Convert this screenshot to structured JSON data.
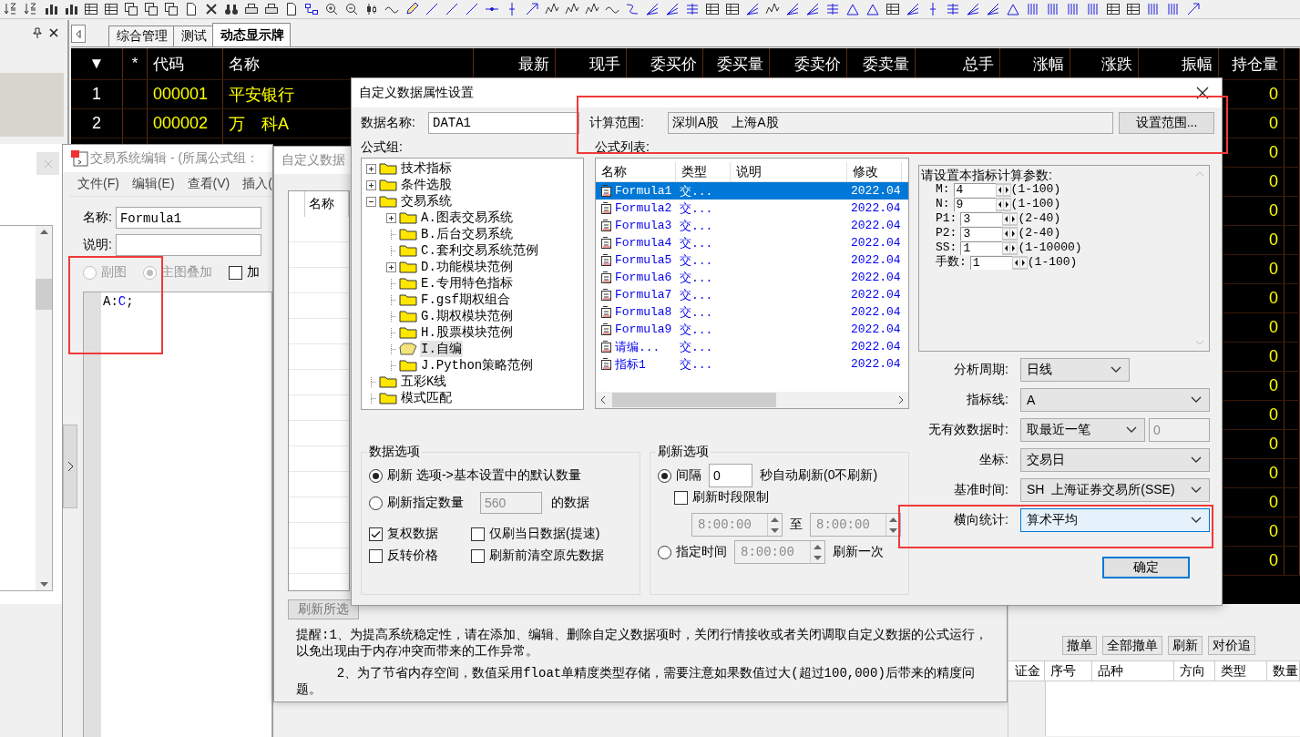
{
  "tabs": [
    {
      "label": "综合管理",
      "selected": false
    },
    {
      "label": "测试",
      "selected": false
    },
    {
      "label": "动态显示牌",
      "selected": true
    }
  ],
  "quote_table": {
    "columns": [
      "▼",
      "*",
      "代码",
      "名称",
      "最新",
      "现手",
      "委买价",
      "委买量",
      "委卖价",
      "委卖量",
      "总手",
      "涨幅",
      "涨跌",
      "振幅",
      "持仓量"
    ],
    "rows": [
      {
        "index": "1",
        "code": "000001",
        "name": "平安银行",
        "open_interest": "0"
      },
      {
        "index": "2",
        "code": "000002",
        "name": "万　科A",
        "open_interest": "0"
      },
      {
        "open_interest": "0"
      },
      {
        "open_interest": "0"
      },
      {
        "open_interest": "0"
      },
      {
        "open_interest": "0"
      },
      {
        "open_interest": "0"
      },
      {
        "open_interest": "0"
      },
      {
        "open_interest": "0"
      },
      {
        "open_interest": "0"
      },
      {
        "open_interest": "0"
      },
      {
        "open_interest": "0"
      },
      {
        "open_interest": "0"
      },
      {
        "open_interest": "0"
      },
      {
        "open_interest": "0"
      },
      {
        "open_interest": "0"
      },
      {
        "open_interest": "0"
      }
    ]
  },
  "editor_window": {
    "title": "交易系统编辑 - (所属公式组：",
    "menu": [
      "文件(F)",
      "编辑(E)",
      "查看(V)",
      "插入("
    ],
    "name_label": "名称:",
    "name_value": "Formula1",
    "desc_label": "说明:",
    "chart_modes": [
      {
        "label": "副图",
        "selected": false,
        "disabled": true
      },
      {
        "label": "主图叠加",
        "selected": true,
        "disabled": true
      }
    ],
    "encrypt": {
      "label": "加",
      "checked": false
    },
    "code": [
      {
        "text": "A:",
        "kind": "plain"
      },
      {
        "text": "C",
        "kind": "keyword"
      },
      {
        "text": ";",
        "kind": "plain"
      }
    ],
    "highlighted": true
  },
  "data_window": {
    "title": "自定义数据",
    "list_columns": [
      "名称"
    ],
    "buttons": [
      "刷新所选"
    ],
    "notes": [
      "提醒:1、为提高系统稳定性，请在添加、编辑、删除自定义数据项时，关闭行情接收或者关闭调取自定义数据的公式运行，以免出现由于内存冲突而带来的工作异常。",
      "2、为了节省内存空间，数值采用float单精度类型存储，需要注意如果数值过大(超过100,000)后带来的精度问题。"
    ]
  },
  "dialog": {
    "title": "自定义数据属性设置",
    "data_name_label": "数据名称:",
    "data_name": "DATA1",
    "range": {
      "label": "计算范围:",
      "value": "深圳A股　上海A股",
      "button": "设置范围...",
      "highlighted": true
    },
    "group_label": "公式组:",
    "list_label": "公式列表:",
    "tree": [
      {
        "label": "技术指标",
        "expandable": true,
        "expanded": false,
        "selected": false
      },
      {
        "label": "条件选股",
        "expandable": true,
        "expanded": false,
        "selected": false
      },
      {
        "label": "交易系统",
        "expandable": true,
        "expanded": true,
        "selected": false,
        "children": [
          {
            "label": "A.图表交易系统",
            "expandable": true,
            "expanded": false,
            "selected": false
          },
          {
            "label": "B.后台交易系统",
            "expandable": false,
            "expanded": false,
            "selected": false
          },
          {
            "label": "C.套利交易系统范例",
            "expandable": false,
            "expanded": false,
            "selected": false
          },
          {
            "label": "D.功能模块范例",
            "expandable": true,
            "expanded": false,
            "selected": false
          },
          {
            "label": "E.专用特色指标",
            "expandable": false,
            "expanded": false,
            "selected": false
          },
          {
            "label": "F.gsf期权组合",
            "expandable": false,
            "expanded": false,
            "selected": false
          },
          {
            "label": "G.期权模块范例",
            "expandable": false,
            "expanded": false,
            "selected": false
          },
          {
            "label": "H.股票模块范例",
            "expandable": false,
            "expanded": false,
            "selected": false
          },
          {
            "label": "I.自编",
            "expandable": false,
            "expanded": false,
            "selected": true
          },
          {
            "label": "J.Python策略范例",
            "expandable": false,
            "expanded": false,
            "selected": false
          }
        ]
      },
      {
        "label": "五彩K线",
        "expandable": false,
        "expanded": false,
        "selected": false
      },
      {
        "label": "模式匹配",
        "expandable": false,
        "expanded": false,
        "selected": false
      }
    ],
    "formula_columns": [
      "名称",
      "类型",
      "说明",
      "修改"
    ],
    "formulas": [
      {
        "name": "Formula1",
        "type": "交...",
        "date": "2022.04",
        "selected": true
      },
      {
        "name": "Formula2",
        "type": "交...",
        "date": "2022.04",
        "selected": false
      },
      {
        "name": "Formula3",
        "type": "交...",
        "date": "2022.04",
        "selected": false
      },
      {
        "name": "Formula4",
        "type": "交...",
        "date": "2022.04",
        "selected": false
      },
      {
        "name": "Formula5",
        "type": "交...",
        "date": "2022.04",
        "selected": false
      },
      {
        "name": "Formula6",
        "type": "交...",
        "date": "2022.04",
        "selected": false
      },
      {
        "name": "Formula7",
        "type": "交...",
        "date": "2022.04",
        "selected": false
      },
      {
        "name": "Formula8",
        "type": "交...",
        "date": "2022.04",
        "selected": false
      },
      {
        "name": "Formula9",
        "type": "交...",
        "date": "2022.04",
        "selected": false
      },
      {
        "name": "请编...",
        "type": "交...",
        "date": "2022.04",
        "selected": false
      },
      {
        "name": "指标1",
        "type": "交...",
        "date": "2022.04",
        "selected": false
      }
    ],
    "params": {
      "prompt": "请设置本指标计算参数:",
      "items": [
        {
          "name": "M:",
          "value": "4",
          "range": "(1-100)"
        },
        {
          "name": "N:",
          "value": "9",
          "range": "(1-100)"
        },
        {
          "name": "P1:",
          "value": "3",
          "range": "(2-40)"
        },
        {
          "name": "P2:",
          "value": "3",
          "range": "(2-40)"
        },
        {
          "name": "SS:",
          "value": "1",
          "range": "(1-10000)"
        },
        {
          "name": "手数:",
          "value": "1",
          "range": "(1-100)"
        }
      ]
    },
    "form": [
      {
        "label": "分析周期:",
        "value": "日线",
        "kind": "short",
        "highlighted": false
      },
      {
        "label": "指标线:",
        "value": "A",
        "kind": "wide",
        "highlighted": false
      },
      {
        "label": "无有效数据时:",
        "value": "取最近一笔",
        "kind": "with_input",
        "extra": "0",
        "highlighted": false
      },
      {
        "label": "坐标:",
        "value": "交易日",
        "kind": "wide",
        "highlighted": false
      },
      {
        "label": "基准时间:",
        "value": "SH  上海证券交易所(SSE)",
        "kind": "wide",
        "highlighted": false
      },
      {
        "label": "横向统计:",
        "value": "算术平均",
        "kind": "wide",
        "highlighted": true
      }
    ],
    "data_options": {
      "title": "数据选项",
      "modes": [
        {
          "label": "刷新 选项->基本设置中的默认数量",
          "selected": true
        },
        {
          "label": "刷新指定数量",
          "selected": false,
          "count": "560",
          "suffix": "的数据"
        }
      ],
      "checks": [
        {
          "label": "复权数据",
          "checked": true
        },
        {
          "label": "仅刷当日数据(提速)",
          "checked": false
        },
        {
          "label": "反转价格",
          "checked": false
        },
        {
          "label": "刷新前清空原先数据",
          "checked": false
        }
      ]
    },
    "refresh_options": {
      "title": "刷新选项",
      "interval": {
        "label": "间隔",
        "selected": true,
        "value": "0",
        "suffix": "秒自动刷新(0不刷新)"
      },
      "period_limit": {
        "label": "刷新时段限制",
        "checked": false,
        "from": "8:00:00",
        "to_label": "至",
        "to": "8:00:00"
      },
      "fixed": {
        "label": "指定时间",
        "selected": false,
        "time": "8:00:00",
        "suffix": "刷新一次"
      }
    },
    "ok_button": "确定"
  },
  "orders_panel": {
    "buttons": [
      "撤单",
      "全部撤单",
      "刷新",
      "对价追"
    ],
    "margin_label": "证金",
    "columns": [
      "序号",
      "品种",
      "方向",
      "类型",
      "数量"
    ]
  }
}
